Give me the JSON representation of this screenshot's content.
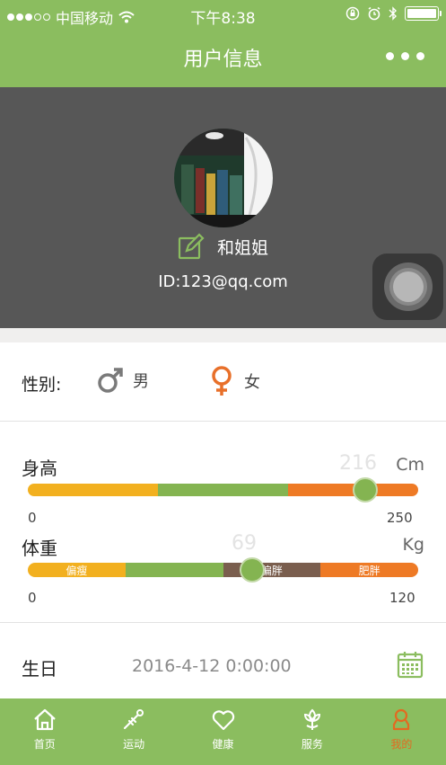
{
  "status_bar": {
    "carrier": "中国移动",
    "time": "下午8:38"
  },
  "nav": {
    "title": "用户信息",
    "more_icon": "more-dots-icon"
  },
  "profile": {
    "name": "和姐姐",
    "id_text": "ID:123@qq.com",
    "edit_icon": "edit-icon"
  },
  "gender": {
    "label": "性别:",
    "options": [
      {
        "label": "男",
        "icon": "male-icon",
        "color": "#7a7a7a"
      },
      {
        "label": "女",
        "icon": "female-icon",
        "color": "#e8702a"
      }
    ]
  },
  "height": {
    "label": "身高",
    "value": "216",
    "unit": "Cm",
    "min": "0",
    "max": "250",
    "segments": [
      {
        "label": "",
        "color": "#f2b01f",
        "fraction": 0.333
      },
      {
        "label": "",
        "color": "#84b451",
        "fraction": 0.334
      },
      {
        "label": "",
        "color": "#ee7a25",
        "fraction": 0.333
      }
    ],
    "level": 0.864
  },
  "weight": {
    "label": "体重",
    "value": "69",
    "unit": "Kg",
    "min": "0",
    "max": "120",
    "segments": [
      {
        "label": "偏瘦",
        "color": "#f2b01f",
        "fraction": 0.25
      },
      {
        "label": "",
        "color": "#84b451",
        "fraction": 0.25
      },
      {
        "label": "偏胖",
        "color": "#7a5e4e",
        "fraction": 0.25
      },
      {
        "label": "肥胖",
        "color": "#ee7a25",
        "fraction": 0.25
      }
    ],
    "level": 0.575
  },
  "birthday": {
    "label": "生日",
    "value": "2016-4-12 0:00:00",
    "icon": "calendar-icon"
  },
  "tabbar": {
    "tabs": [
      {
        "label": "首页",
        "icon": "home-icon",
        "active": false
      },
      {
        "label": "运动",
        "icon": "sport-icon",
        "active": false
      },
      {
        "label": "健康",
        "icon": "heart-icon",
        "active": false
      },
      {
        "label": "服务",
        "icon": "service-icon",
        "active": false
      },
      {
        "label": "我的",
        "icon": "person-icon",
        "active": true
      }
    ]
  },
  "colors": {
    "brand_green": "#8bbd5f",
    "header_gray": "#575757",
    "active_orange": "#e36a20"
  }
}
